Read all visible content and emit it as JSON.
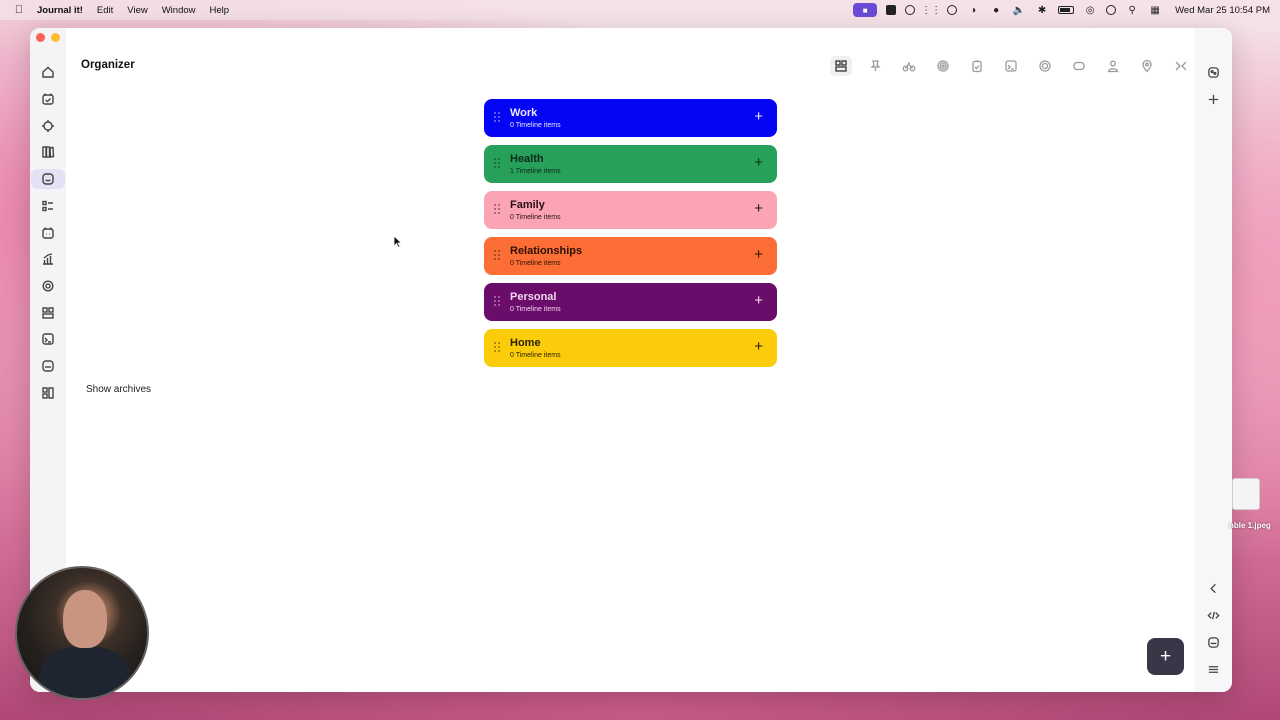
{
  "menubar": {
    "app_name": "Journal it!",
    "menus": [
      "Edit",
      "View",
      "Window",
      "Help"
    ],
    "clock": "Wed Mar 25  10:54 PM"
  },
  "window": {
    "title": "Organizer"
  },
  "categories": [
    {
      "name": "Work",
      "sub": "0 Timeline items",
      "color": "#0505f5",
      "text_color": "#e9e9ff"
    },
    {
      "name": "Health",
      "sub": "1 Timeline items",
      "color": "#27a05a",
      "text_color": "#0f2a1a"
    },
    {
      "name": "Family",
      "sub": "0 Timeline items",
      "color": "#fba5b4",
      "text_color": "#2a1015"
    },
    {
      "name": "Relationships",
      "sub": "0 Timeline items",
      "color": "#fd6d36",
      "text_color": "#2a1206"
    },
    {
      "name": "Personal",
      "sub": "0 Timeline items",
      "color": "#6a0c6a",
      "text_color": "#f1d9f1"
    },
    {
      "name": "Home",
      "sub": "0 Timeline items",
      "color": "#fccc0a",
      "text_color": "#2a2204"
    }
  ],
  "show_archives": "Show archives",
  "fab_label": "+",
  "desktop_file": "nble 1.jpeg",
  "icons": {
    "sidebar": [
      "home-icon",
      "calendar-icon",
      "crosshair-icon",
      "books-icon",
      "organizer-icon",
      "list-icon",
      "calendar-grid-icon",
      "chart-icon",
      "gear-icon",
      "widgets-icon",
      "journal-icon",
      "inbox-icon",
      "layout-icon"
    ],
    "toolbar": [
      "layout-grid-icon",
      "pin-icon",
      "bike-icon",
      "target-icon",
      "clipboard-icon",
      "note-icon",
      "spiral-icon",
      "tag-icon",
      "person-icon",
      "location-icon",
      "collapse-icon"
    ],
    "right_rail": [
      "ai-icon",
      "plus-icon",
      "chevron-left-icon",
      "code-icon",
      "inbox-icon",
      "menu-icon"
    ]
  }
}
